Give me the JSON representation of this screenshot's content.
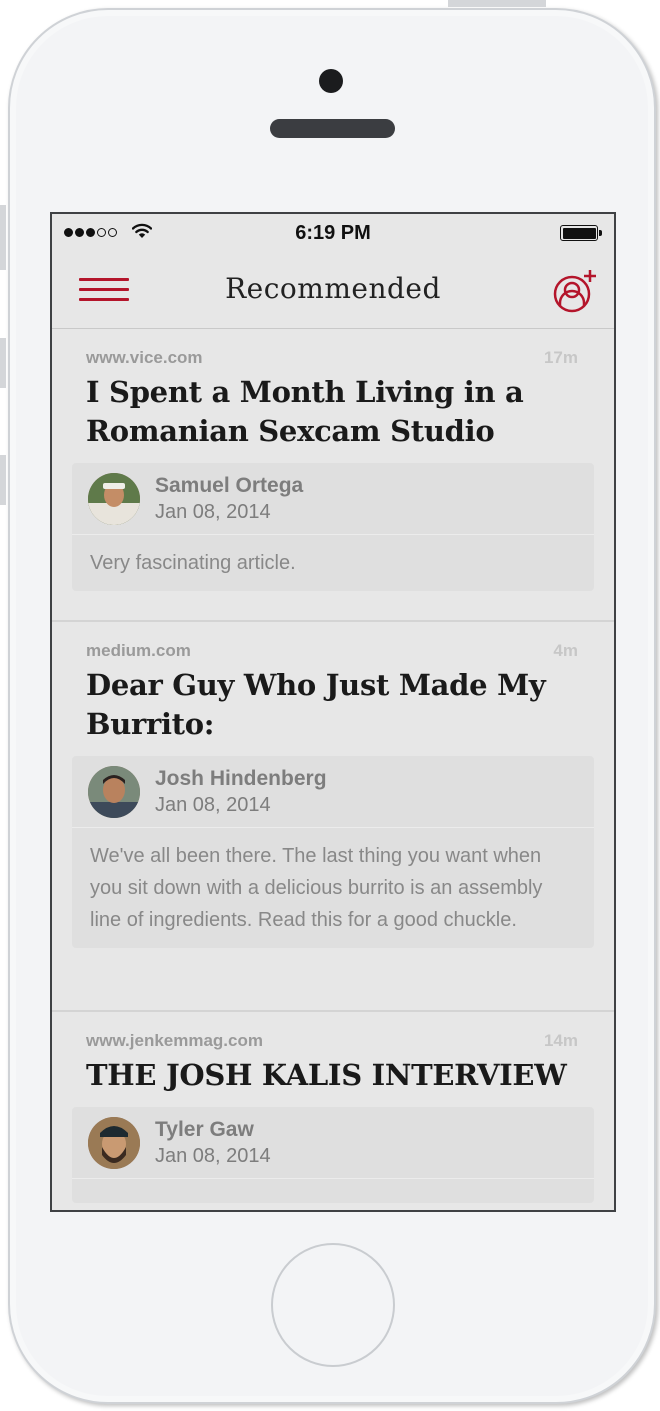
{
  "status_bar": {
    "time": "6:19 PM",
    "signal_icon": "signal-dots-icon",
    "wifi_icon": "wifi-icon",
    "battery_icon": "battery-icon"
  },
  "navbar": {
    "title": "Recommended",
    "menu_icon": "hamburger-menu-icon",
    "add_user_icon": "add-user-icon",
    "accent_color": "#b4152b"
  },
  "posts": [
    {
      "source": "www.vice.com",
      "age": "17m",
      "title": "I Spent a Month Living in a Romanian Sexcam Studio",
      "user": "Samuel Ortega",
      "date": "Jan 08, 2014",
      "comment": "Very fascinating article."
    },
    {
      "source": "medium.com",
      "age": "4m",
      "title": "Dear Guy Who Just Made My Burrito:",
      "user": "Josh Hindenberg",
      "date": "Jan 08, 2014",
      "comment": "We've all been there. The last thing you want when you sit down with a delicious burrito is an assembly line of ingredients. Read this for a good chuckle."
    },
    {
      "source": "www.jenkemmag.com",
      "age": "14m",
      "title": "THE JOSH KALIS INTERVIEW",
      "user": "Tyler Gaw",
      "date": "Jan 08, 2014",
      "comment": ""
    }
  ]
}
